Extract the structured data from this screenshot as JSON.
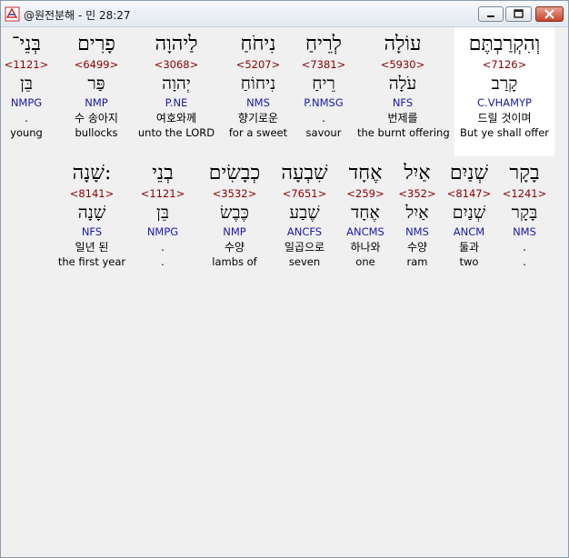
{
  "window": {
    "title": "@원전분해 - 민 28:27"
  },
  "rows": [
    [
      {
        "hebrew": "בְּנֵי־",
        "strong": "<1121>",
        "lemma": "בֵּן",
        "morph": "NMPG",
        "korean": ".",
        "english": "young"
      },
      {
        "hebrew": "פָרִים",
        "strong": "<6499>",
        "lemma": "פַּר",
        "morph": "NMP",
        "korean": "수 송아지",
        "english": "bullocks"
      },
      {
        "hebrew": "לַיהוָה",
        "strong": "<3068>",
        "lemma": "יְהוָה",
        "morph": "P.NE",
        "korean": "여호와께",
        "english": "unto the LORD"
      },
      {
        "hebrew": "נִיחֹחַ",
        "strong": "<5207>",
        "lemma": "נִיחוֹחַ",
        "morph": "NMS",
        "korean": "향기로운",
        "english": "for a sweet"
      },
      {
        "hebrew": "לְרֵיחַ",
        "strong": "<7381>",
        "lemma": "רֵיחַ",
        "morph": "P.NMSG",
        "korean": ".",
        "english": "savour"
      },
      {
        "hebrew": "עוֹלָה",
        "strong": "<5930>",
        "lemma": "עֹלָה",
        "morph": "NFS",
        "korean": "번제를",
        "english": "the burnt offering"
      },
      {
        "hebrew": "וְהִקְרַבְתֶּם",
        "strong": "<7126>",
        "lemma": "קָרַב",
        "morph": "C.VHAMYP",
        "korean": "드릴 것이며",
        "english": "But ye shall offer",
        "highlight": true
      }
    ],
    [
      {
        "hebrew": "שָׁנָה:",
        "strong": "<8141>",
        "lemma": "שָׁנָה",
        "morph": "NFS",
        "korean": "일년 된",
        "english": "the first year"
      },
      {
        "hebrew": "בְנֵי",
        "strong": "<1121>",
        "lemma": "בֵּן",
        "morph": "NMPG",
        "korean": ".",
        "english": "."
      },
      {
        "hebrew": "כְבָשִׂים",
        "strong": "<3532>",
        "lemma": "כֶּבֶשׂ",
        "morph": "NMP",
        "korean": "수양",
        "english": "lambs of"
      },
      {
        "hebrew": "שִׁבְעָה",
        "strong": "<7651>",
        "lemma": "שֶׁבַע",
        "morph": "ANCFS",
        "korean": "일곱으로",
        "english": "seven"
      },
      {
        "hebrew": "אֶחָד",
        "strong": "<259>",
        "lemma": "אֶחָד",
        "morph": "ANCMS",
        "korean": "하나와",
        "english": "one"
      },
      {
        "hebrew": "אַיִל",
        "strong": "<352>",
        "lemma": "אַיִל",
        "morph": "NMS",
        "korean": "수양",
        "english": "ram"
      },
      {
        "hebrew": "שְׁנַיִם",
        "strong": "<8147>",
        "lemma": "שְׁנַיִם",
        "morph": "ANCM",
        "korean": "둘과",
        "english": "two"
      },
      {
        "hebrew": "בָקָר",
        "strong": "<1241>",
        "lemma": "בָּקָר",
        "morph": "NMS",
        "korean": ".",
        "english": "."
      }
    ]
  ]
}
